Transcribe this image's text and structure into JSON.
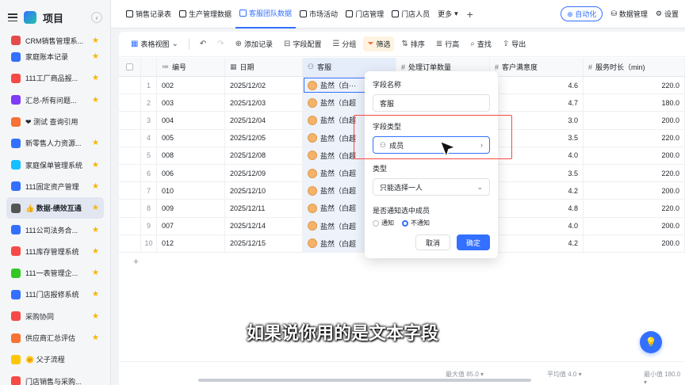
{
  "project": {
    "title": "项目"
  },
  "sidebar": {
    "items": [
      {
        "label": "CRM销售管理系...",
        "color": "#e54b4b",
        "starred": true
      },
      {
        "label": "家庭账本记录",
        "color": "#3370ff",
        "starred": true
      },
      {
        "label": "111工厂商品报...",
        "color": "#f54a45",
        "starred": true
      },
      {
        "label": "汇总-所有问题...",
        "color": "#7f3bf5",
        "starred": true
      },
      {
        "label": "❤ 测试 查询引用",
        "color": "#f77234",
        "starred": false
      },
      {
        "label": "新零售人力资源...",
        "color": "#3370ff",
        "starred": true
      },
      {
        "label": "家庭保单管理系统",
        "color": "#14c0ff",
        "starred": true
      },
      {
        "label": "111固定资产管理",
        "color": "#3370ff",
        "starred": true
      },
      {
        "label": "👍 数据-绩效互通",
        "color": "#555555",
        "starred": true,
        "active": true
      },
      {
        "label": "111公司法务合...",
        "color": "#3370ff",
        "starred": true
      },
      {
        "label": "111库存管理系统",
        "color": "#f54a45",
        "starred": true
      },
      {
        "label": "111一表管理企...",
        "color": "#34c724",
        "starred": true
      },
      {
        "label": "111门店报修系统",
        "color": "#3370ff",
        "starred": true
      },
      {
        "label": "采购协同",
        "color": "#f54a45",
        "starred": true
      },
      {
        "label": "供应商汇总评估",
        "color": "#f77234",
        "starred": true
      },
      {
        "label": "🌞 父子流程",
        "color": "#ffc60a",
        "starred": false
      },
      {
        "label": "门店销售与采购...",
        "color": "#f54a45",
        "starred": false
      }
    ]
  },
  "tabs": [
    {
      "label": "销售记录表",
      "active": false
    },
    {
      "label": "生产管理数据",
      "active": false
    },
    {
      "label": "客服团队数据",
      "active": true
    },
    {
      "label": "市场活动",
      "active": false
    },
    {
      "label": "门店管理",
      "active": false
    },
    {
      "label": "门店人员",
      "active": false
    },
    {
      "label": "更多",
      "active": false
    }
  ],
  "topRight": {
    "automation": "⊕ 自动化",
    "dataManage": "数据管理",
    "settings": "设置"
  },
  "toolbar": {
    "view": "表格视图",
    "addRecord": "添加记录",
    "fieldConfig": "字段配置",
    "group": "分组",
    "filter": "筛选",
    "sort": "排序",
    "rowHeight": "行高",
    "search": "查找",
    "export": "导出"
  },
  "table": {
    "headers": {
      "id": "编号",
      "date": "日期",
      "cs": "客服",
      "orders": "处理订单数量",
      "sat": "客户满意度",
      "dur": "服务时长（min)"
    },
    "rows": [
      {
        "no": "1",
        "id": "002",
        "date": "2025/12/02",
        "cs": "盐然（白···",
        "sat": "4.6",
        "dur": "220.0"
      },
      {
        "no": "2",
        "id": "003",
        "date": "2025/12/03",
        "cs": "盐然（白超",
        "sat": "4.7",
        "dur": "180.0"
      },
      {
        "no": "3",
        "id": "004",
        "date": "2025/12/04",
        "cs": "盐然（白超",
        "sat": "3.0",
        "dur": "200.0"
      },
      {
        "no": "4",
        "id": "005",
        "date": "2025/12/05",
        "cs": "盐然（白超",
        "sat": "3.5",
        "dur": "220.0"
      },
      {
        "no": "5",
        "id": "008",
        "date": "2025/12/08",
        "cs": "盐然（白超",
        "sat": "4.0",
        "dur": "200.0"
      },
      {
        "no": "6",
        "id": "006",
        "date": "2025/12/09",
        "cs": "盐然（白超",
        "sat": "3.5",
        "dur": "220.0"
      },
      {
        "no": "7",
        "id": "010",
        "date": "2025/12/10",
        "cs": "盐然（白超",
        "sat": "4.2",
        "dur": "200.0"
      },
      {
        "no": "8",
        "id": "009",
        "date": "2025/12/11",
        "cs": "盐然（白超",
        "sat": "4.8",
        "dur": "220.0"
      },
      {
        "no": "9",
        "id": "007",
        "date": "2025/12/14",
        "cs": "盐然（白超",
        "sat": "4.0",
        "dur": "200.0"
      },
      {
        "no": "10",
        "id": "012",
        "date": "2025/12/15",
        "cs": "盐然（白超",
        "sat": "4.2",
        "dur": "200.0"
      }
    ],
    "addRow": "+"
  },
  "status": {
    "max": "最大值 85.0 ▾",
    "avg": "平均值 4.0 ▾",
    "min": "最小值 180.0 ▾"
  },
  "popup": {
    "nameLabel": "字段名称",
    "nameValue": "客服",
    "typeLabel": "字段类型",
    "typeValue": "成员",
    "kindLabel": "类型",
    "kindValue": "只能选择一人",
    "notifyLabel": "是否通知选中成员",
    "notifyYes": "通知",
    "notifyNo": "不通知",
    "cancel": "取消",
    "confirm": "确定"
  },
  "subtitle": "如果说你用的是文本字段"
}
